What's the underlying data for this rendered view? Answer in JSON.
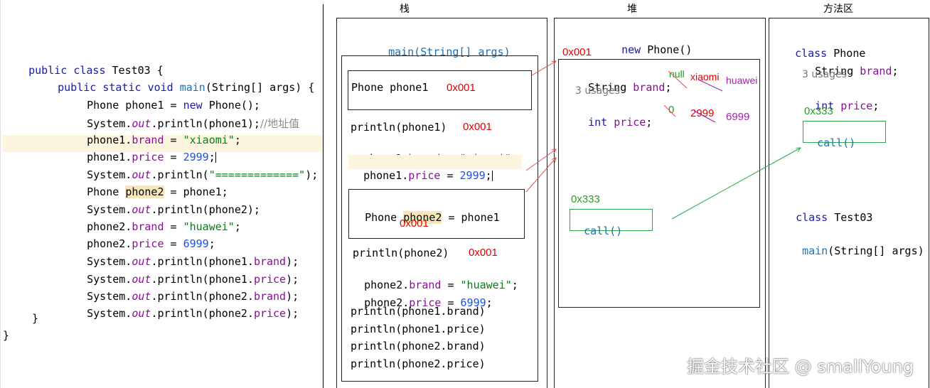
{
  "code": {
    "class_decl": [
      "public ",
      "class ",
      "Test03 {"
    ],
    "main_decl": [
      "public ",
      "static ",
      "void ",
      "main",
      "(String[] args) {"
    ],
    "lines": {
      "l1": [
        "Phone phone1 = ",
        "new ",
        "Phone();"
      ],
      "l2": [
        "System.",
        "out",
        ".println(phone1);",
        "//地址值"
      ],
      "l3": [
        "phone1.",
        "brand",
        " = ",
        "\"xiaomi\"",
        ";"
      ],
      "l4": [
        "phone1.",
        "price",
        " = ",
        "2999",
        ";"
      ],
      "l5": [
        "System.",
        "out",
        ".println(",
        "\"=============\"",
        ");"
      ],
      "l6": [
        "Phone ",
        "phone2",
        " = phone1;"
      ],
      "l7": [
        "System.",
        "out",
        ".println(phone2);"
      ],
      "l8": [
        "phone2.",
        "brand",
        " = ",
        "\"huawei\"",
        ";"
      ],
      "l9": [
        "phone2.",
        "price",
        " = ",
        "6999",
        ";"
      ],
      "l10": [
        "System.",
        "out",
        ".println(phone1.",
        "brand",
        ");"
      ],
      "l11": [
        "System.",
        "out",
        ".println(phone1.",
        "price",
        ");"
      ],
      "l12": [
        "System.",
        "out",
        ".println(phone2.",
        "brand",
        ");"
      ],
      "l13": [
        "System.",
        "out",
        ".println(phone2.",
        "price",
        ");"
      ]
    },
    "close1": "}",
    "close2": "}"
  },
  "stack": {
    "title": "栈",
    "main_sig": "main(String[] args)",
    "phone1_decl": "Phone phone1",
    "phone1_addr": "0x001",
    "println_phone1": "println(phone1)",
    "println_phone1_addr": "0x001",
    "brand_assign": [
      "phone1.",
      "brand",
      " = ",
      "\"xiaomi\"",
      ";"
    ],
    "price_assign": [
      "phone1.",
      "price",
      " = ",
      "2999",
      ";"
    ],
    "phone2_decl": [
      "Phone ",
      "phone2",
      " = phone1"
    ],
    "phone2_addr": "0x001",
    "println_phone2": "println(phone2)",
    "println_phone2_addr": "0x001",
    "brand2_assign": [
      "phone2.",
      "brand",
      " = ",
      "\"huawei\"",
      ";"
    ],
    "price2_assign": [
      "phone2.",
      "price",
      " = ",
      "6999",
      ";"
    ],
    "print1": "println(phone1.brand)",
    "print2": "println(phone1.price)",
    "print3": "println(phone2.brand)",
    "print4": "println(phone2.price)"
  },
  "heap": {
    "title": "堆",
    "new_phone": [
      "new ",
      "Phone()"
    ],
    "addr": "0x001",
    "brand_field": [
      "String ",
      "brand",
      ";"
    ],
    "brand_null": "null",
    "brand_xiaomi": "xiaomi",
    "brand_huawei": "huawei",
    "usages": "3 usages",
    "price_field": [
      "int ",
      "price",
      ";"
    ],
    "price_zero": "0",
    "price_2999": "2999",
    "price_6999": "6999",
    "method_addr": "0x333",
    "method_call": "call()"
  },
  "method_area": {
    "title": "方法区",
    "phone_class": [
      "class ",
      "Phone"
    ],
    "brand_field": [
      "String ",
      "brand",
      ";"
    ],
    "usages": "3 usages",
    "price_field": [
      "int ",
      "price",
      ";"
    ],
    "method_addr": "0x333",
    "method_call": "call()",
    "test_class": [
      "class ",
      "Test03"
    ],
    "main_sig": [
      "main",
      "(String[] args)"
    ]
  },
  "watermark": "掘金技术社区 @ smallYoung"
}
